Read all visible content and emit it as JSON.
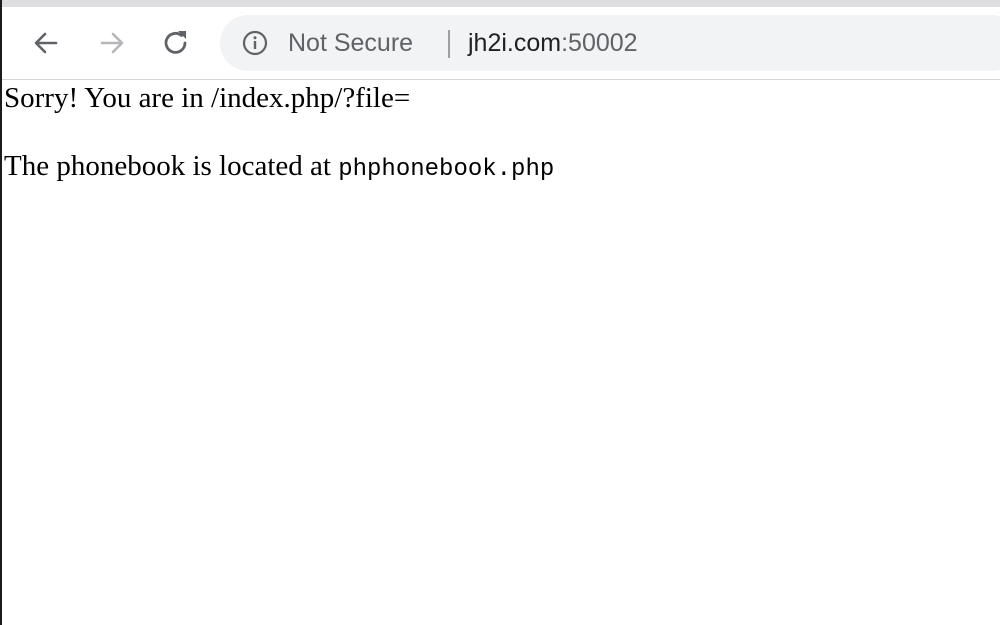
{
  "browser": {
    "security_label": "Not Secure",
    "url_host": "jh2i.com",
    "url_port": ":50002",
    "icons": {
      "back": "back-arrow-icon",
      "forward": "forward-arrow-icon",
      "reload": "reload-icon",
      "info": "info-icon"
    }
  },
  "page": {
    "line1": "Sorry! You are in /index.php/?file=",
    "line2_text": "The phonebook is located at ",
    "line2_code": "phphonebook.php"
  }
}
